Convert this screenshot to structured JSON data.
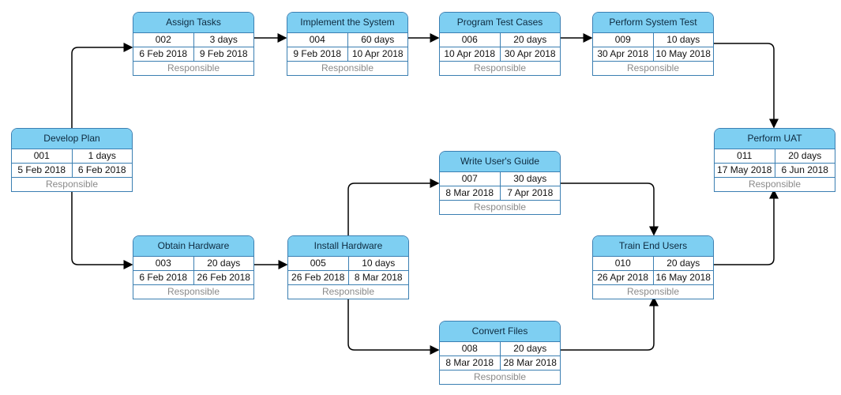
{
  "tasks": [
    {
      "name": "Develop Plan",
      "id": "001",
      "duration": "1 days",
      "start": "5 Feb 2018",
      "end": "6 Feb 2018",
      "responsible": "Responsible"
    },
    {
      "name": "Assign Tasks",
      "id": "002",
      "duration": "3 days",
      "start": "6 Feb 2018",
      "end": "9 Feb 2018",
      "responsible": "Responsible"
    },
    {
      "name": "Obtain Hardware",
      "id": "003",
      "duration": "20 days",
      "start": "6 Feb 2018",
      "end": "26 Feb 2018",
      "responsible": "Responsible"
    },
    {
      "name": "Implement the System",
      "id": "004",
      "duration": "60 days",
      "start": "9 Feb 2018",
      "end": "10 Apr 2018",
      "responsible": "Responsible"
    },
    {
      "name": "Install Hardware",
      "id": "005",
      "duration": "10 days",
      "start": "26 Feb 2018",
      "end": "8 Mar 2018",
      "responsible": "Responsible"
    },
    {
      "name": "Program Test Cases",
      "id": "006",
      "duration": "20 days",
      "start": "10 Apr 2018",
      "end": "30 Apr 2018",
      "responsible": "Responsible"
    },
    {
      "name": "Write User's Guide",
      "id": "007",
      "duration": "30 days",
      "start": "8 Mar 2018",
      "end": "7 Apr 2018",
      "responsible": "Responsible"
    },
    {
      "name": "Convert Files",
      "id": "008",
      "duration": "20 days",
      "start": "8 Mar 2018",
      "end": "28 Mar 2018",
      "responsible": "Responsible"
    },
    {
      "name": "Perform System Test",
      "id": "009",
      "duration": "10 days",
      "start": "30 Apr 2018",
      "end": "10 May 2018",
      "responsible": "Responsible"
    },
    {
      "name": "Train End Users",
      "id": "010",
      "duration": "20 days",
      "start": "26 Apr 2018",
      "end": "16 May 2018",
      "responsible": "Responsible"
    },
    {
      "name": "Perform UAT",
      "id": "011",
      "duration": "20 days",
      "start": "17 May 2018",
      "end": "6 Jun 2018",
      "responsible": "Responsible"
    }
  ],
  "colors": {
    "header": "#7ecff2",
    "border": "#3b7fb2",
    "edge": "#000000"
  }
}
